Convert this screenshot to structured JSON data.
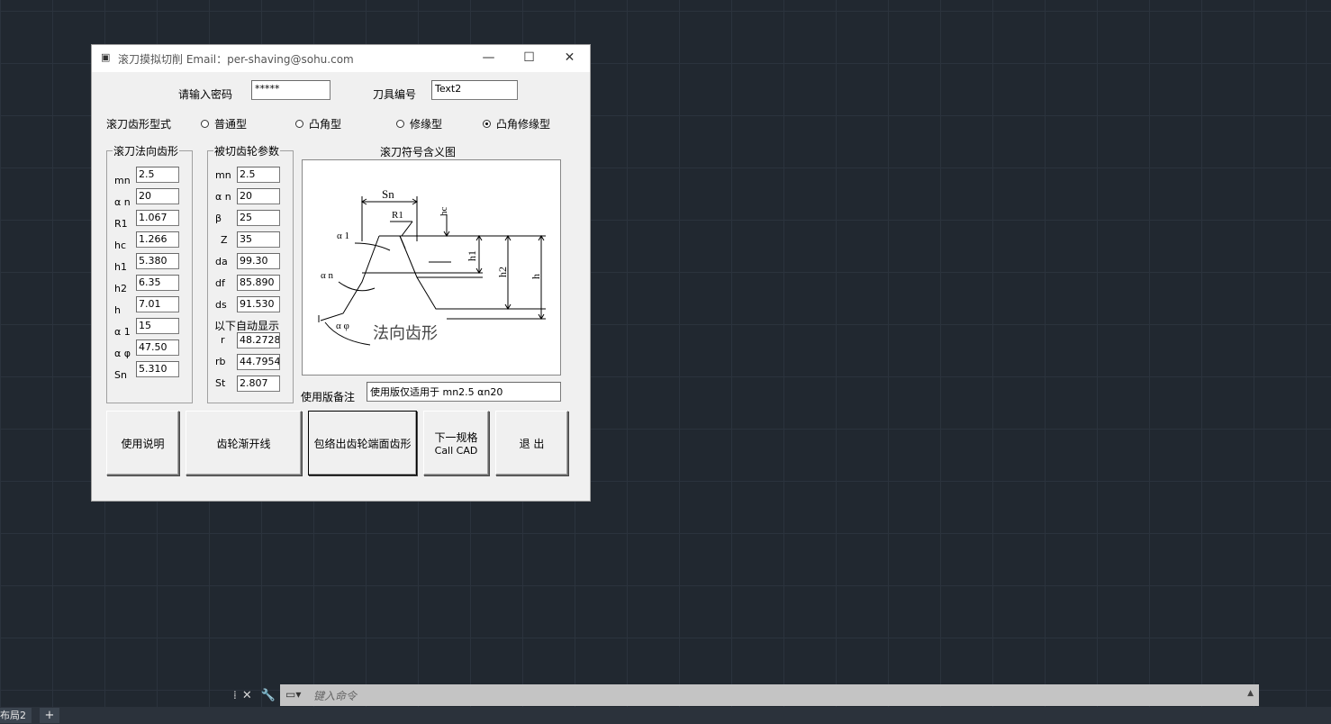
{
  "window": {
    "title": "滚刀摸拟切削 Email：per-shaving@sohu.com",
    "icon": "app-icon",
    "controls": {
      "minimize": "—",
      "maximize": "☐",
      "close": "✕"
    }
  },
  "top": {
    "password_label": "请输入密码",
    "password_value": "*****",
    "tool_label": "刀具编号",
    "tool_value": "Text2"
  },
  "profile": {
    "label": "滚刀齿形型式",
    "options": [
      "普通型",
      "凸角型",
      "修缘型",
      "凸角修缘型"
    ],
    "selected": "凸角修缘型"
  },
  "normal_profile": {
    "title": "滚刀法向齿形",
    "fields": [
      {
        "label": "mn",
        "value": "2.5"
      },
      {
        "label": "α n",
        "value": "20"
      },
      {
        "label": "R1",
        "value": "1.067"
      },
      {
        "label": "hc",
        "value": "1.266"
      },
      {
        "label": "h1",
        "value": "5.380"
      },
      {
        "label": "h2",
        "value": "6.35"
      },
      {
        "label": "h",
        "value": "7.01"
      },
      {
        "label": "α 1",
        "value": "15"
      },
      {
        "label": "α φ",
        "value": "47.50"
      },
      {
        "label": "Sn",
        "value": "5.310"
      }
    ]
  },
  "gear_params": {
    "title": "被切齿轮参数",
    "fields": [
      {
        "label": "mn",
        "value": "2.5"
      },
      {
        "label": "α n",
        "value": "20"
      },
      {
        "label": "β",
        "value": "25"
      },
      {
        "label": "Z",
        "value": "35"
      },
      {
        "label": "da",
        "value": "99.30"
      },
      {
        "label": "df",
        "value": "85.890"
      },
      {
        "label": "ds",
        "value": "91.530"
      }
    ],
    "auto_label": "以下自动显示",
    "auto_fields": [
      {
        "label": "r",
        "value": "48.2728"
      },
      {
        "label": "rb",
        "value": "44.7954"
      },
      {
        "label": "St",
        "value": "2.807"
      }
    ]
  },
  "diagram": {
    "title": "滚刀符号含义图",
    "labels": {
      "sn": "Sn",
      "r1": "R1",
      "hc": "hc",
      "a1": "α 1",
      "h1": "h1",
      "h2": "h2",
      "h": "h",
      "an": "α n",
      "aphi": "α φ",
      "caption": "法向齿形"
    }
  },
  "note": {
    "label": "使用版备注",
    "value": "使用版仅适用于 mn2.5 αn20"
  },
  "buttons": {
    "help": "使用说明",
    "involute": "齿轮渐开线",
    "envelope": "包络出齿轮端面齿形",
    "next_line1": "下一规格",
    "next_line2": "Call CAD",
    "exit": "退 出"
  },
  "cad": {
    "command_placeholder": "键入命令",
    "layout_tab": "布局2",
    "add_tab": "+"
  }
}
